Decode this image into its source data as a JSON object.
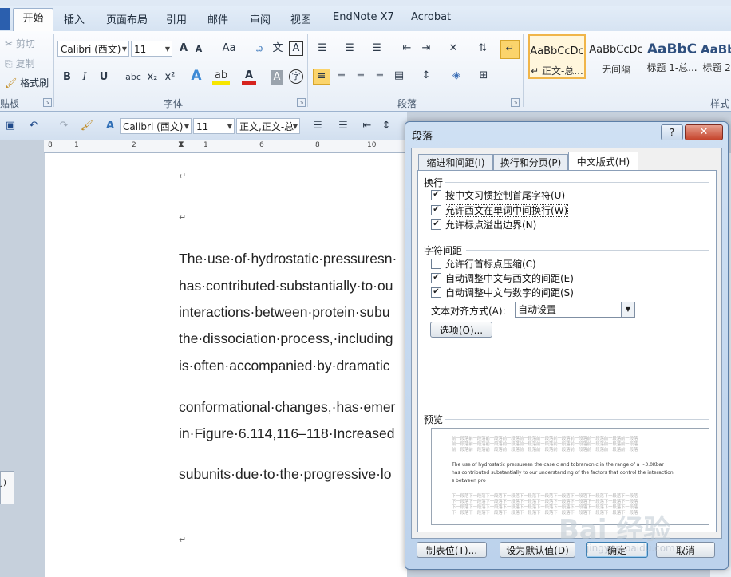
{
  "ribbon_tabs": [
    "开始",
    "插入",
    "页面布局",
    "引用",
    "邮件",
    "审阅",
    "视图",
    "EndNote X7",
    "Acrobat"
  ],
  "clipboard": {
    "cut": "剪切",
    "copy": "复制",
    "format_painter": "格式刷",
    "group_label": "贴板"
  },
  "font_group": {
    "font_name": "Calibri (西文)",
    "font_size": "11",
    "grow": "A",
    "shrink": "A",
    "case": "Aa",
    "bold": "B",
    "italic": "I",
    "underline": "U",
    "strike": "abc",
    "sub": "x₂",
    "sup": "x²",
    "group_label": "字体"
  },
  "paragraph_group": {
    "group_label": "段落"
  },
  "styles": [
    {
      "sample": "AaBbCcDc",
      "name": "↵ 正文-总..."
    },
    {
      "sample": "AaBbCcDc",
      "name": "无间隔"
    },
    {
      "sample": "AaBbC",
      "name": "标题 1-总..."
    },
    {
      "sample": "AaBb",
      "name": "标题 2"
    }
  ],
  "styles_group_label": "样式",
  "qat": {
    "font_name": "Calibri (西文)",
    "font_size": "11",
    "style": "正文,正文-总"
  },
  "ruler": {
    "marks": [
      "8",
      "1",
      "2",
      "1",
      "4",
      "6",
      "8",
      "10",
      "12"
    ]
  },
  "document": {
    "lines": [
      "The·use·of·hydrostatic·pressuresn·",
      "has·contributed·substantially·to·ou",
      "interactions·between·protein·subu",
      "the·dissociation·process,·including",
      "is·often·accompanied·by·dramatic",
      "conformational·changes,·has·emer",
      "in·Figure·6.114,116–118·Increased",
      "subunits·due·to·the·progressive·lo"
    ],
    "para_mark": "↵"
  },
  "side_popup": "J)",
  "dialog": {
    "title": "段落",
    "help": "?",
    "close": "✕",
    "tabs": [
      "缩进和间距(I)",
      "换行和分页(P)",
      "中文版式(H)"
    ],
    "wrap_section": "换行",
    "wrap_options": [
      {
        "label": "按中文习惯控制首尾字符(U)",
        "checked": true
      },
      {
        "label": "允许西文在单词中间换行(W)",
        "checked": true
      },
      {
        "label": "允许标点溢出边界(N)",
        "checked": true
      }
    ],
    "spacing_section": "字符间距",
    "spacing_options": [
      {
        "label": "允许行首标点压缩(C)",
        "checked": false
      },
      {
        "label": "自动调整中文与西文的间距(E)",
        "checked": true
      },
      {
        "label": "自动调整中文与数字的间距(S)",
        "checked": true
      }
    ],
    "text_align_label": "文本对齐方式(A):",
    "text_align_value": "自动设置",
    "options_button": "选项(O)...",
    "preview_label": "预览",
    "preview_grey": "前一段落前一段落前一段落前一段落前一段落前一段落前一段落前一段落前一段落前一段落前一段落",
    "preview_text_1": "The use of hydrostatic pressuresn the case      c and tobramonic in the range of a ~3.0Kbar",
    "preview_text_2": "has contributed substantially to our understanding of the factors that control the interaction",
    "preview_text_3": "s between pro",
    "preview_next": "下一段落下一段落下一段落下一段落下一段落下一段落下一段落下一段落下一段落下一段落下一段落",
    "tabstops_button": "制表位(T)...",
    "default_button": "设为默认值(D)",
    "ok_button": "确定",
    "cancel_button": "取消"
  },
  "watermark": "Bai 经验",
  "watermark_url": "jingyan.baidu.com"
}
